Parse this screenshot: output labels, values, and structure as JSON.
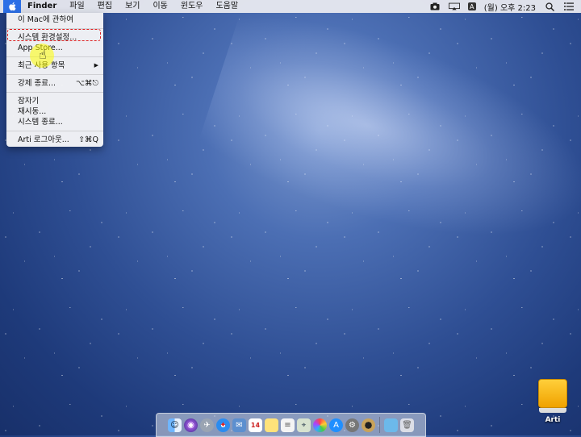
{
  "menubar": {
    "items": [
      "Finder",
      "파일",
      "편집",
      "보기",
      "이동",
      "윈도우",
      "도움말"
    ],
    "clock": "(월) 오후 2:23",
    "input_badge": "A"
  },
  "apple_menu": {
    "about": "이 Mac에 관하여",
    "prefs": "시스템 환경설정...",
    "app_store": "App Store...",
    "recent": "최근 사용 항목",
    "recent_arrow": "▶",
    "force_quit": "강제 종료...",
    "force_quit_shortcut": "⌥⌘⎋",
    "sleep": "잠자기",
    "restart": "재시동...",
    "shutdown": "시스템 종료...",
    "logout": "Arti 로그아웃...",
    "logout_shortcut": "⇧⌘Q"
  },
  "desktop": {
    "disk_label": "Arti"
  },
  "dock": {
    "calendar_day": "14"
  },
  "colors": {
    "accent": "#2c6fe6",
    "highlight_border": "#dd2222"
  }
}
